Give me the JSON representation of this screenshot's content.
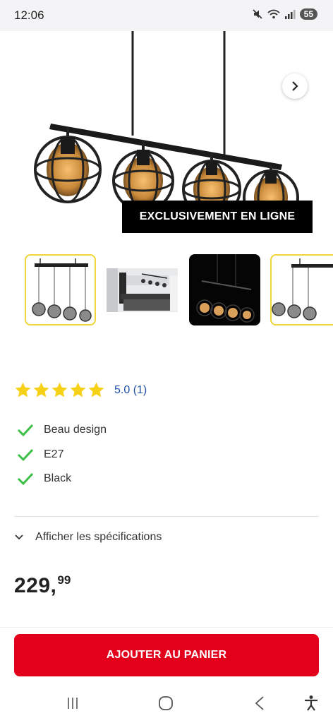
{
  "status_bar": {
    "time": "12:06",
    "battery": "55",
    "icons": [
      "mute-icon",
      "wifi-icon",
      "signal-icon"
    ]
  },
  "product_gallery": {
    "badge": "EXCLUSIVEMENT EN LIGNE",
    "thumbnails": [
      "lamp-white-background",
      "kitchen-scene",
      "lamp-dark-background",
      "lamp-white-background-alt"
    ]
  },
  "rating": {
    "stars": 5,
    "text": "5.0 (1)",
    "star_color": "#f7d117",
    "text_color": "#1f4fa8"
  },
  "features": [
    {
      "label": "Beau design"
    },
    {
      "label": "E27"
    },
    {
      "label": "Black"
    }
  ],
  "specs": {
    "label": "Afficher les spécifications"
  },
  "price": {
    "main": "229,",
    "cents": "99"
  },
  "cart": {
    "button_label": "AJOUTER AU PANIER",
    "button_color": "#e2001a"
  },
  "navigation": {
    "buttons": [
      "recent-apps-icon",
      "home-icon",
      "back-icon",
      "accessibility-icon"
    ]
  },
  "colors": {
    "check": "#3bbf46",
    "thumb_selected_border": "#f0d63a"
  }
}
